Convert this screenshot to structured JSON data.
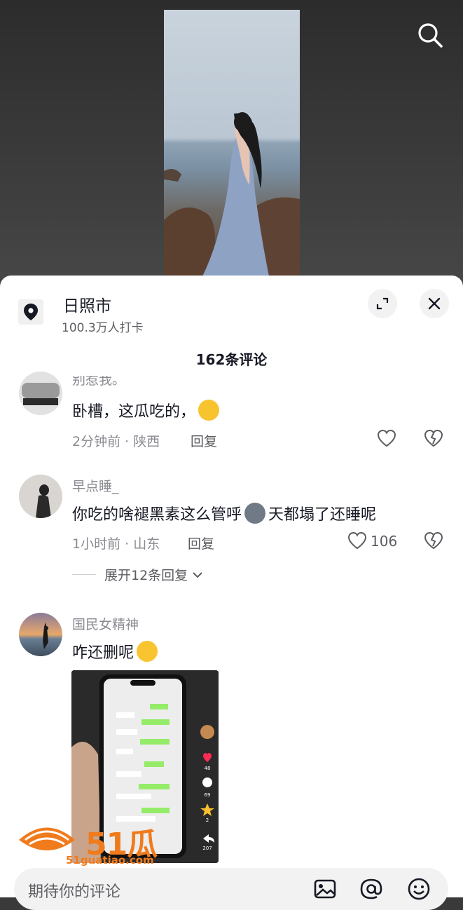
{
  "location": {
    "title": "日照市",
    "checkins": "100.3万人打卡"
  },
  "comments_header": "162条评论",
  "comments": [
    {
      "username": "别惹我。",
      "text": "卧槽，这瓜吃的，",
      "emoji": "crying-laughing-emoji",
      "time_place": "2分钟前 · 陕西",
      "reply_label": "回复",
      "likes": ""
    },
    {
      "username": "早点睡_",
      "text_before": "你吃的啥褪黑素这么管呼",
      "emoji": "husky-dog-emoji",
      "text_after": "天都塌了还睡呢",
      "time_place": "1小时前 · 山东",
      "reply_label": "回复",
      "likes": "106",
      "expand_label": "展开12条回复"
    },
    {
      "username": "国民女精神",
      "text": "咋还删呢",
      "emoji": "laughing-tears-emoji",
      "image": {
        "likes": "48",
        "comments": "69",
        "favorites": "2",
        "shares": "207"
      }
    }
  ],
  "watermark": {
    "brand": "51瓜条",
    "url": "51guatiao.com"
  },
  "input": {
    "placeholder": "期待你的评论"
  },
  "colors": {
    "text_primary": "#161823",
    "text_secondary": "#8a8b91",
    "watermark_orange": "#f07b1d"
  }
}
